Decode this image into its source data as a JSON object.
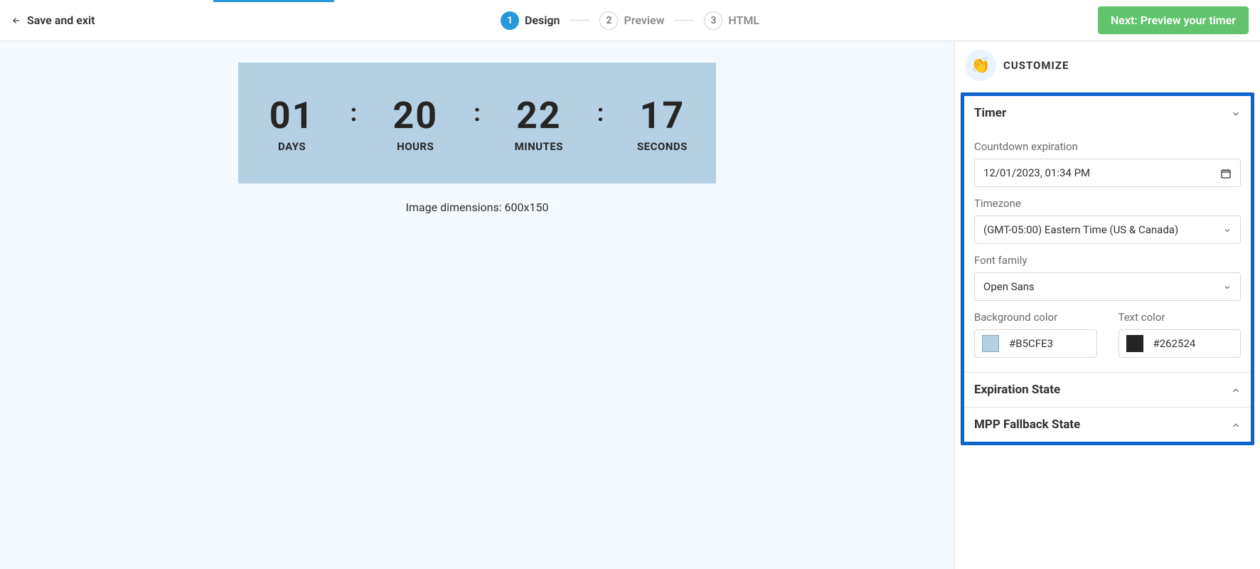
{
  "topbar": {
    "save_exit": "Save and exit",
    "steps": [
      {
        "num": "1",
        "label": "Design"
      },
      {
        "num": "2",
        "label": "Preview"
      },
      {
        "num": "3",
        "label": "HTML"
      }
    ],
    "next": "Next: Preview your timer"
  },
  "preview": {
    "units": [
      {
        "value": "01",
        "label": "DAYS"
      },
      {
        "value": "20",
        "label": "HOURS"
      },
      {
        "value": "22",
        "label": "MINUTES"
      },
      {
        "value": "17",
        "label": "SECONDS"
      }
    ],
    "dimensions": "Image dimensions: 600x150",
    "bg_color": "#B5CFE3",
    "text_color": "#262524"
  },
  "panel": {
    "title": "CUSTOMIZE",
    "timer": {
      "title": "Timer",
      "countdown_label": "Countdown expiration",
      "countdown_value": "12/01/2023, 01:34 PM",
      "timezone_label": "Timezone",
      "timezone_value": "(GMT-05:00) Eastern Time (US & Canada)",
      "font_label": "Font family",
      "font_value": "Open Sans",
      "bg_label": "Background color",
      "bg_value": "#B5CFE3",
      "text_label": "Text color",
      "text_value": "#262524"
    },
    "expiration_title": "Expiration State",
    "mpp_title": "MPP Fallback State"
  }
}
